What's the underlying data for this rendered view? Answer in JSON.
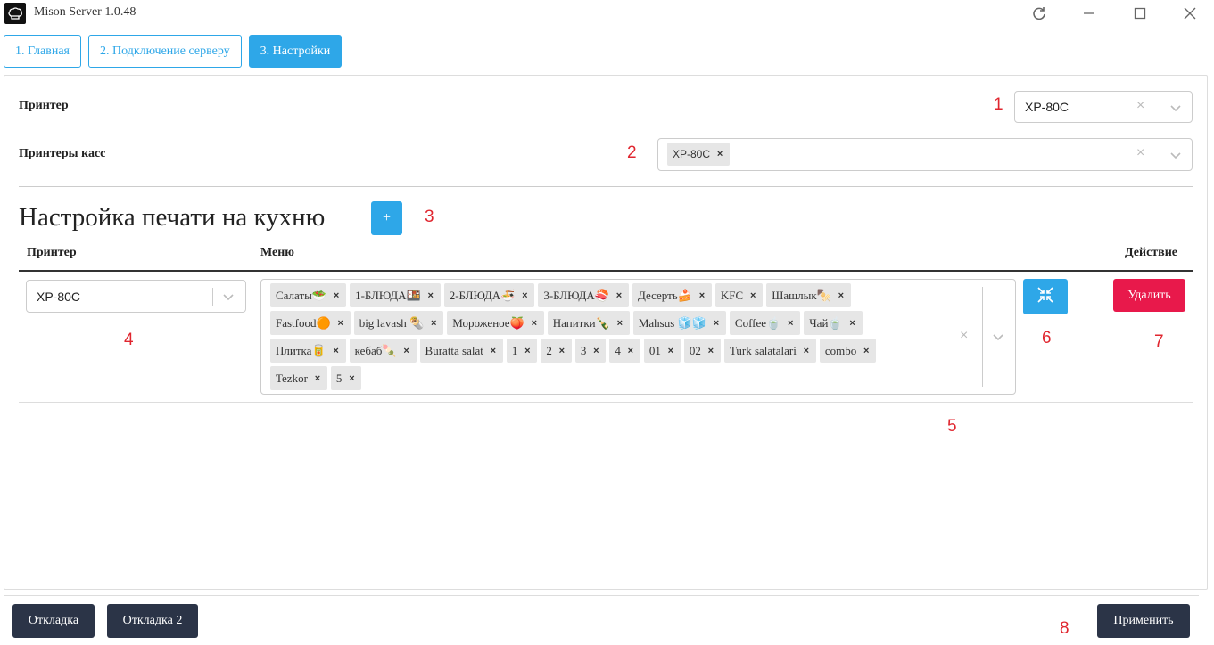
{
  "window": {
    "title": "Mison Server 1.0.48",
    "icons": [
      "app-logo",
      "refresh-icon",
      "minimize-icon",
      "maximize-icon",
      "close-icon"
    ]
  },
  "tabs": [
    {
      "label": "1. Главная",
      "active": false
    },
    {
      "label": "2. Подключение серверу",
      "active": false
    },
    {
      "label": "3. Настройки",
      "active": true
    }
  ],
  "settings": {
    "printer_label": "Принтер",
    "printer_value": "XP-80C",
    "cash_printers_label": "Принтеры касс",
    "cash_printers_chip": "XP-80C",
    "clear_symbol": "×"
  },
  "kitchen": {
    "title": "Настройка печати на кухню",
    "add_label": "+",
    "columns": {
      "printer": "Принтер",
      "menu": "Меню",
      "action": "Действие"
    },
    "row": {
      "printer": "XP-80C",
      "menu_items": [
        "Салаты🥗",
        "1-БЛЮДА🍱",
        "2-БЛЮДА🍜",
        "3-БЛЮДА🍣",
        "Десерть🍰",
        "KFC",
        "Шашлык🍢",
        "Fastfood🟠",
        "big lavash 🌯",
        "Мороженое🍑",
        "Напитки🍾",
        "Mahsus 🧊🧊",
        "Coffee🍵",
        "Чай🍵",
        "Плитка🥫",
        "кебаб🍡",
        "Buratta salat",
        "1",
        "2",
        "3",
        "4",
        "01",
        "02",
        "Turk salatalari",
        "combo",
        "Tezkor",
        "5"
      ],
      "delete_label": "Удалить"
    }
  },
  "annotations": [
    "1",
    "2",
    "3",
    "4",
    "5",
    "6",
    "7",
    "8"
  ],
  "footer": {
    "debug_label": "Откладка",
    "debug2_label": "Откладка 2",
    "apply_label": "Применить"
  },
  "colors": {
    "accent": "#2ea7e8",
    "danger": "#e8194b",
    "dark_button": "#2b3447",
    "annotation": "#e0262f"
  }
}
